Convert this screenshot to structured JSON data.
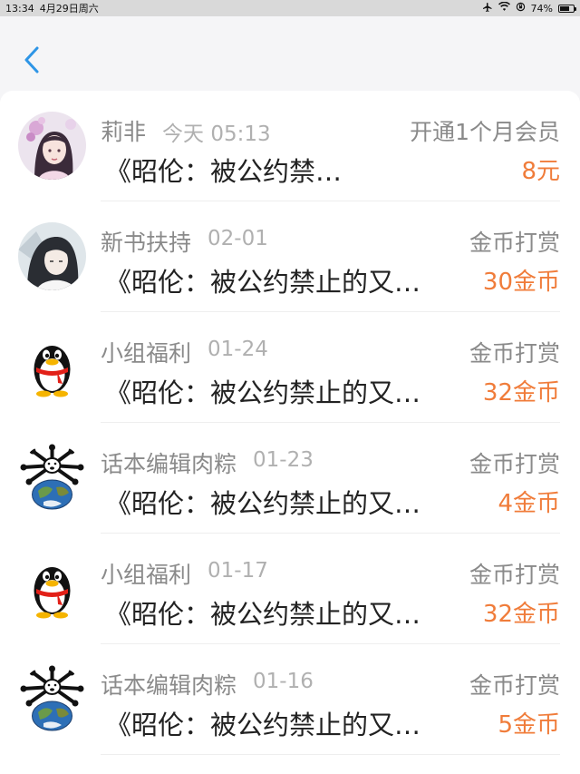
{
  "status_bar": {
    "time": "13:34",
    "date": "4月29日周六",
    "battery": "74%",
    "battery_level": 0.74
  },
  "nav": {
    "back_icon": "chevron-left-icon",
    "accent_color": "#2e95e6"
  },
  "colors": {
    "amount": "#f07c3a",
    "name": "#8a8a8a",
    "time": "#b0b0b0"
  },
  "items": [
    {
      "name": "莉非",
      "time": "今天 05:13",
      "type": "开通1个月会员",
      "book": "《昭伦：被公约禁…",
      "amount": "8元",
      "avatar": "anime-girl-avatar"
    },
    {
      "name": "新书扶持",
      "time": "02-01",
      "type": "金币打赏",
      "book": "《昭伦：被公约禁止的又…",
      "amount": "30金币",
      "avatar": "anime-boy-avatar"
    },
    {
      "name": "小组福利",
      "time": "01-24",
      "type": "金币打赏",
      "book": "《昭伦：被公约禁止的又…",
      "amount": "32金币",
      "avatar": "penguin-avatar"
    },
    {
      "name": "话本编辑肉粽",
      "time": "01-23",
      "type": "金币打赏",
      "book": "《昭伦：被公约禁止的又…",
      "amount": "4金币",
      "avatar": "earth-dog-avatar"
    },
    {
      "name": "小组福利",
      "time": "01-17",
      "type": "金币打赏",
      "book": "《昭伦：被公约禁止的又…",
      "amount": "32金币",
      "avatar": "penguin-avatar"
    },
    {
      "name": "话本编辑肉粽",
      "time": "01-16",
      "type": "金币打赏",
      "book": "《昭伦：被公约禁止的又…",
      "amount": "5金币",
      "avatar": "earth-dog-avatar"
    }
  ]
}
